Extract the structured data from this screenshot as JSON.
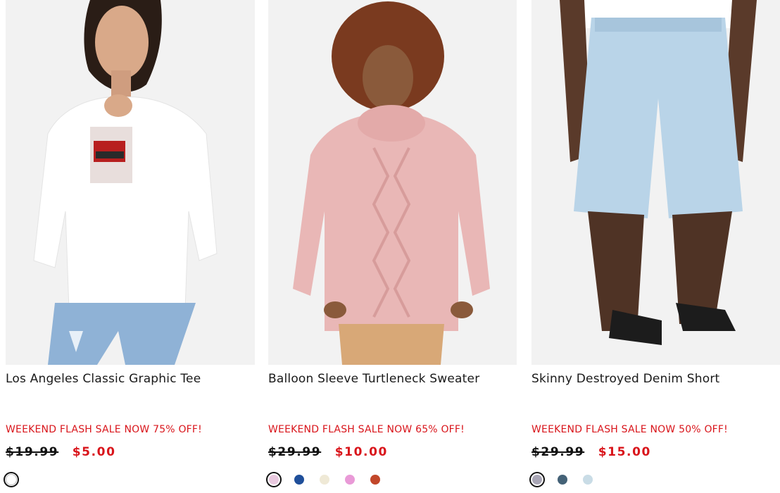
{
  "products": [
    {
      "name": "Los Angeles Classic Graphic Tee",
      "promo": "WEEKEND FLASH SALE NOW 75% OFF!",
      "original_price": "$19.99",
      "sale_price": "$5.00",
      "swatches": [
        "#ffffff"
      ]
    },
    {
      "name": "Balloon Sleeve Turtleneck Sweater",
      "promo": "WEEKEND FLASH SALE NOW 65% OFF!",
      "original_price": "$29.99",
      "sale_price": "$10.00",
      "swatches": [
        "#e9c9df",
        "#1f4f9a",
        "#efe9d6",
        "#e99ad7",
        "#c2472a"
      ]
    },
    {
      "name": "Skinny Destroyed Denim Short",
      "promo": "WEEKEND FLASH SALE NOW 50% OFF!",
      "original_price": "$29.99",
      "sale_price": "$15.00",
      "swatches": [
        "#a9a6b6",
        "#446277",
        "#c9dce6"
      ]
    }
  ],
  "colors": {
    "sale_red": "#d9151b",
    "text": "#1a1a1a"
  }
}
